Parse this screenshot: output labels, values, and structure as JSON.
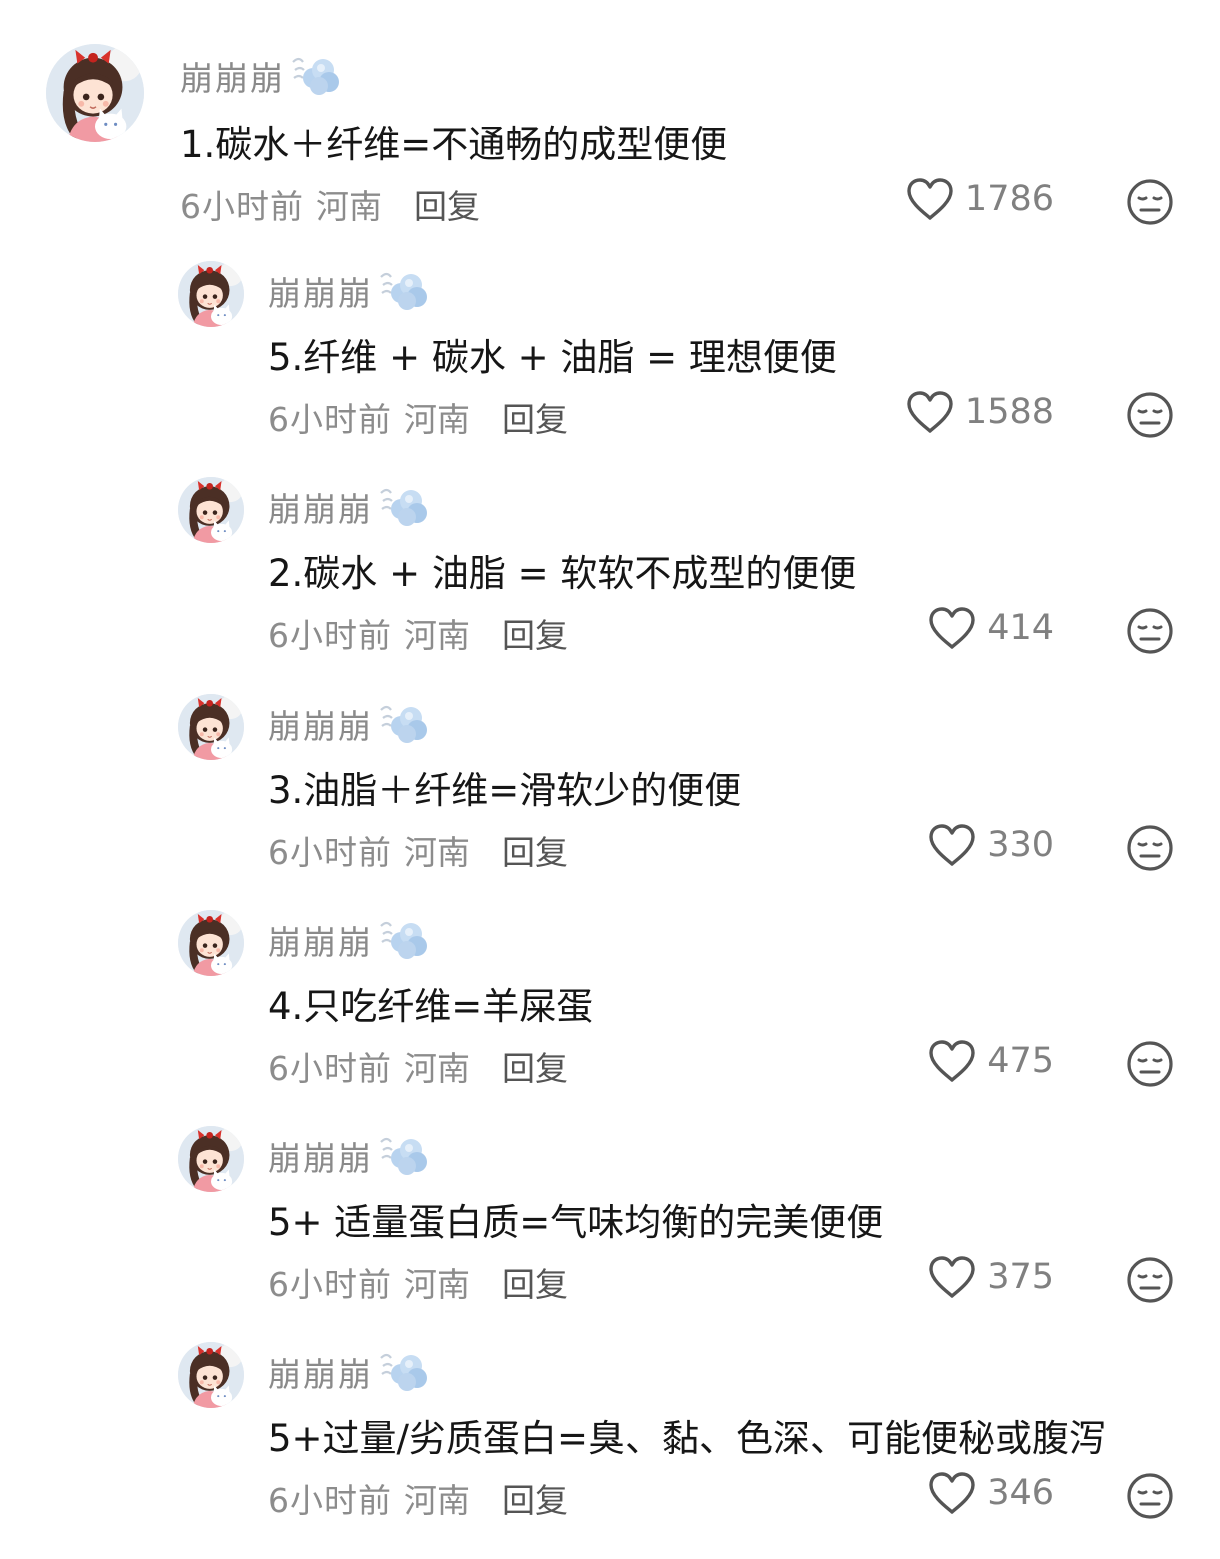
{
  "comments": [
    {
      "username": "崩崩崩",
      "content": "1.碳水＋纤维=不通畅的成型便便",
      "time": "6小时前",
      "location": "河南",
      "reply_label": "回复",
      "likes": "1786"
    },
    {
      "username": "崩崩崩",
      "content": "5.纤维 + 碳水 + 油脂 = 理想便便",
      "time": "6小时前",
      "location": "河南",
      "reply_label": "回复",
      "likes": "1588"
    },
    {
      "username": "崩崩崩",
      "content": "2.碳水 + 油脂 = 软软不成型的便便",
      "time": "6小时前",
      "location": "河南",
      "reply_label": "回复",
      "likes": "414"
    },
    {
      "username": "崩崩崩",
      "content": "3.油脂＋纤维=滑软少的便便",
      "time": "6小时前",
      "location": "河南",
      "reply_label": "回复",
      "likes": "330"
    },
    {
      "username": "崩崩崩",
      "content": "4.只吃纤维=羊屎蛋",
      "time": "6小时前",
      "location": "河南",
      "reply_label": "回复",
      "likes": "475"
    },
    {
      "username": "崩崩崩",
      "content": "5+ 适量蛋白质=气味均衡的完美便便",
      "time": "6小时前",
      "location": "河南",
      "reply_label": "回复",
      "likes": "375"
    },
    {
      "username": "崩崩崩",
      "content": "5+过量/劣质蛋白=臭、黏、色深、可能便秘或腹泻",
      "time": "6小时前",
      "location": "河南",
      "reply_label": "回复",
      "likes": "346"
    }
  ],
  "icons": {
    "like": "heart-outline-icon",
    "dislike": "neutral-face-icon",
    "badge": "wind-cloud-icon"
  },
  "colors": {
    "username": "#8a8a8a",
    "content": "#161616",
    "meta": "#8c8c8c",
    "badge": "#bcd4ee"
  }
}
